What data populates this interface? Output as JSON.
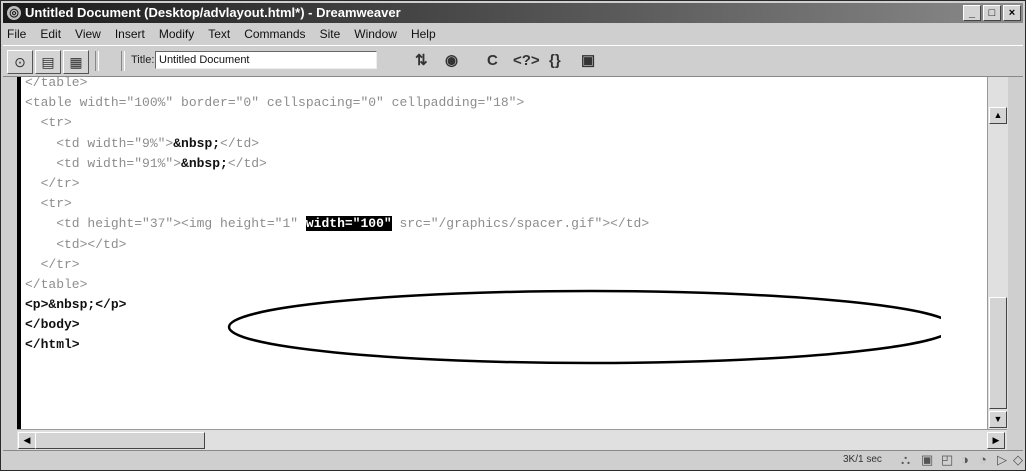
{
  "window": {
    "title": "Untitled Document (Desktop/advlayout.html*) - Dreamweaver",
    "controls": [
      "_",
      "□",
      "×"
    ]
  },
  "menubar": [
    "File",
    "Edit",
    "View",
    "Insert",
    "Modify",
    "Text",
    "Commands",
    "Site",
    "Window",
    "Help"
  ],
  "toolbar": {
    "title_label": "Title:",
    "title_value": "Untitled Document",
    "icons": [
      "code-view-icon",
      "split-view-icon",
      "design-view-icon",
      "file-management-icon",
      "preview-browser-icon",
      "refresh-icon",
      "reference-icon",
      "code-navigation-icon",
      "view-options-icon"
    ]
  },
  "code_lines": [
    {
      "text": "</table>",
      "style": "normal"
    },
    {
      "text": "<table width=\"100%\" border=\"0\" cellspacing=\"0\" cellpadding=\"18\">",
      "style": "normal"
    },
    {
      "text": "  <tr>",
      "style": "normal"
    },
    {
      "parts": [
        {
          "t": "    <td width=\"9%\">",
          "s": "normal"
        },
        {
          "t": "&nbsp;",
          "s": "bold"
        },
        {
          "t": "</td>",
          "s": "normal"
        }
      ]
    },
    {
      "parts": [
        {
          "t": "    <td width=\"91%\">",
          "s": "normal"
        },
        {
          "t": "&nbsp;",
          "s": "bold"
        },
        {
          "t": "</td>",
          "s": "normal"
        }
      ]
    },
    {
      "text": "  </tr>",
      "style": "normal"
    },
    {
      "text": "  <tr>",
      "style": "normal"
    },
    {
      "parts": [
        {
          "t": "    <td height=\"37\"><img height=\"1\" ",
          "s": "normal"
        },
        {
          "t": "width=\"100\"",
          "s": "highlight"
        },
        {
          "t": " src=\"/graphics/spacer.gif\"></td>",
          "s": "normal"
        }
      ]
    },
    {
      "text": "    <td></td>",
      "style": "normal"
    },
    {
      "text": "  </tr>",
      "style": "normal"
    },
    {
      "text": "</table>",
      "style": "normal"
    },
    {
      "parts": [
        {
          "t": "<p>&nbsp;</p>",
          "s": "bold"
        }
      ]
    },
    {
      "parts": [
        {
          "t": "</body>",
          "s": "bold"
        }
      ]
    },
    {
      "parts": [
        {
          "t": "</html>",
          "s": "bold"
        }
      ]
    }
  ],
  "statusbar": {
    "size_label": "3K/1 sec",
    "icons": [
      "site-icon",
      "assets-icon",
      "html-styles-icon",
      "css-styles-icon",
      "behaviors-icon",
      "history-icon",
      "code-inspector-icon"
    ]
  }
}
